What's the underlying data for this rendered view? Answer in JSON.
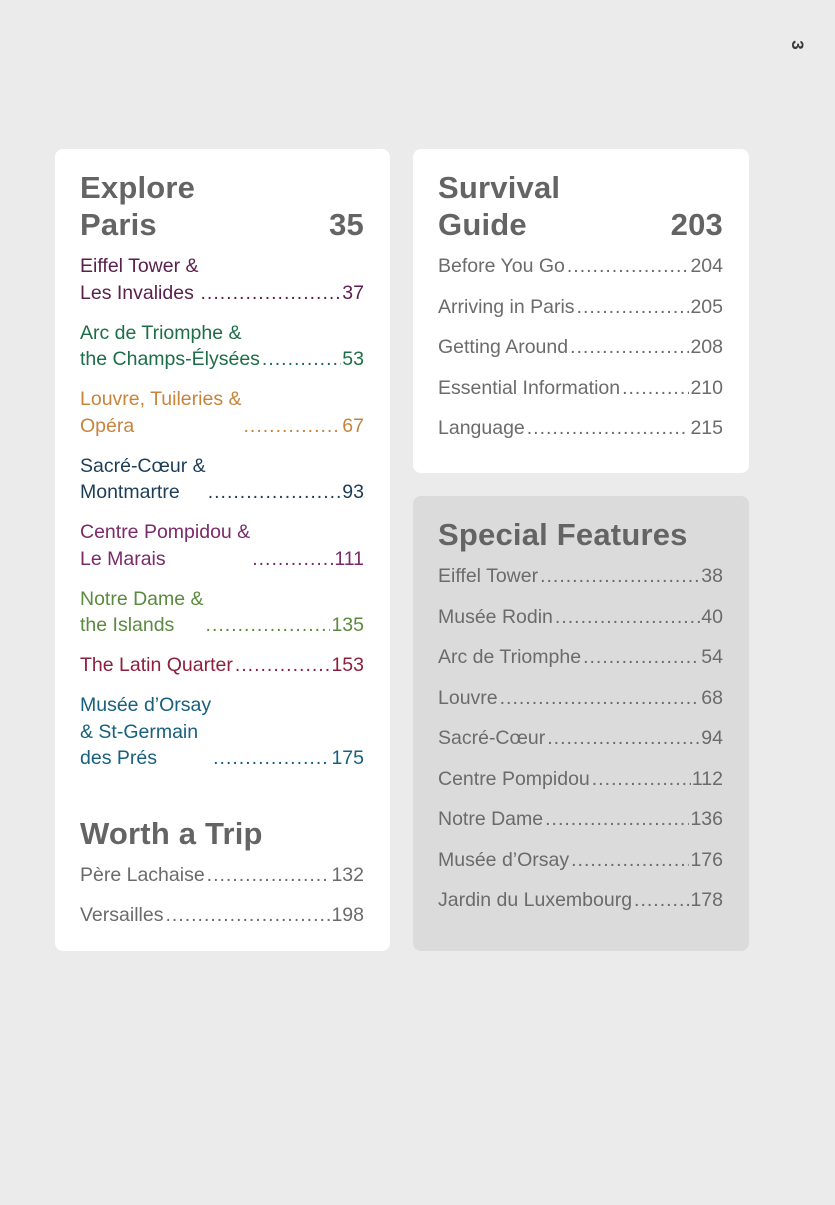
{
  "page_number": "3",
  "colors": {
    "background": "#ebebeb",
    "card_white": "#ffffff",
    "card_grey": "#dcdbdb",
    "heading": "#646464",
    "plain_text": "#6b6b6b"
  },
  "explore": {
    "title": "Explore\nParis",
    "page": "35",
    "entries": [
      {
        "line1": "Eiffel Tower &",
        "line2": "Les Invalides",
        "page": "37",
        "color": "#5a1f4b"
      },
      {
        "line1": "Arc de Triomphe &",
        "line2": "the Champs-Élysées",
        "page": "53",
        "color": "#1d6e47"
      },
      {
        "line1": "Louvre, Tuileries &",
        "line2": "Opéra",
        "page": "67",
        "color": "#c8843c"
      },
      {
        "line1": "Sacré-Cœur &",
        "line2": "Montmartre",
        "page": "93",
        "color": "#1c3d57"
      },
      {
        "line1": "Centre Pompidou &",
        "line2": "Le Marais",
        "page": "111",
        "color": "#7a2a6a"
      },
      {
        "line1": "Notre Dame &",
        "line2": "the Islands",
        "page": "135",
        "color": "#5b8a3e"
      },
      {
        "line1": "",
        "line2": "The Latin Quarter",
        "page": "153",
        "color": "#8c1f3d"
      },
      {
        "line1": "Musée d’Orsay\n& St-Germain",
        "line2": "des Prés",
        "page": "175",
        "color": "#17607e"
      }
    ]
  },
  "worth_a_trip": {
    "title": "Worth a Trip",
    "entries": [
      {
        "label": "Père Lachaise",
        "page": "132"
      },
      {
        "label": "Versailles",
        "page": "198"
      }
    ]
  },
  "survival": {
    "title": "Survival\nGuide",
    "page": "203",
    "entries": [
      {
        "label": "Before You Go",
        "page": "204"
      },
      {
        "label": "Arriving in Paris",
        "page": "205"
      },
      {
        "label": "Getting Around",
        "page": "208"
      },
      {
        "label": "Essential Information",
        "page": "210"
      },
      {
        "label": "Language",
        "page": "215"
      }
    ]
  },
  "special_features": {
    "title": "Special Features",
    "entries": [
      {
        "label": "Eiffel Tower",
        "page": "38"
      },
      {
        "label": "Musée Rodin",
        "page": "40"
      },
      {
        "label": "Arc de Triomphe",
        "page": "54"
      },
      {
        "label": "Louvre",
        "page": "68"
      },
      {
        "label": "Sacré-Cœur",
        "page": "94"
      },
      {
        "label": "Centre Pompidou",
        "page": "112"
      },
      {
        "label": "Notre Dame",
        "page": "136"
      },
      {
        "label": "Musée d’Orsay",
        "page": "176"
      },
      {
        "label": "Jardin du Luxembourg",
        "page": "178"
      }
    ]
  }
}
